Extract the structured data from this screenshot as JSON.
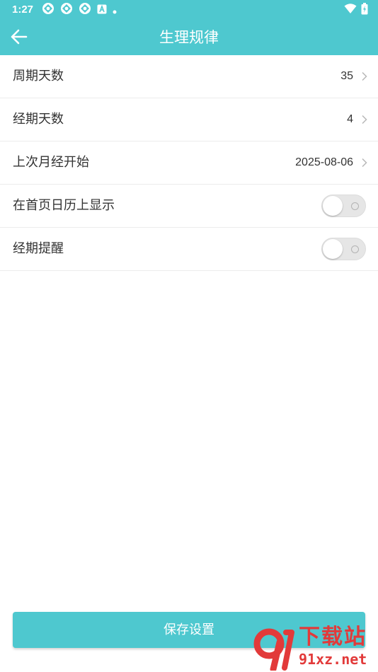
{
  "status_bar": {
    "time": "1:27",
    "left_icons": [
      "app-notification-icon",
      "app-notification-icon",
      "app-notification-icon",
      "font-app-icon",
      "dot-icon"
    ],
    "right_icons": [
      "wifi-icon",
      "battery-icon"
    ]
  },
  "header": {
    "title": "生理规律",
    "background_color": "#4ec8cf"
  },
  "settings": {
    "cycle_days": {
      "label": "周期天数",
      "value": "35"
    },
    "period_days": {
      "label": "经期天数",
      "value": "4"
    },
    "last_period_start": {
      "label": "上次月经开始",
      "value": "2025-08-06"
    },
    "show_on_home_calendar": {
      "label": "在首页日历上显示",
      "enabled": false
    },
    "period_reminder": {
      "label": "经期提醒",
      "enabled": false
    }
  },
  "save_button": {
    "label": "保存设置"
  },
  "watermark": {
    "title": "下载站",
    "url": "91xz.net"
  }
}
